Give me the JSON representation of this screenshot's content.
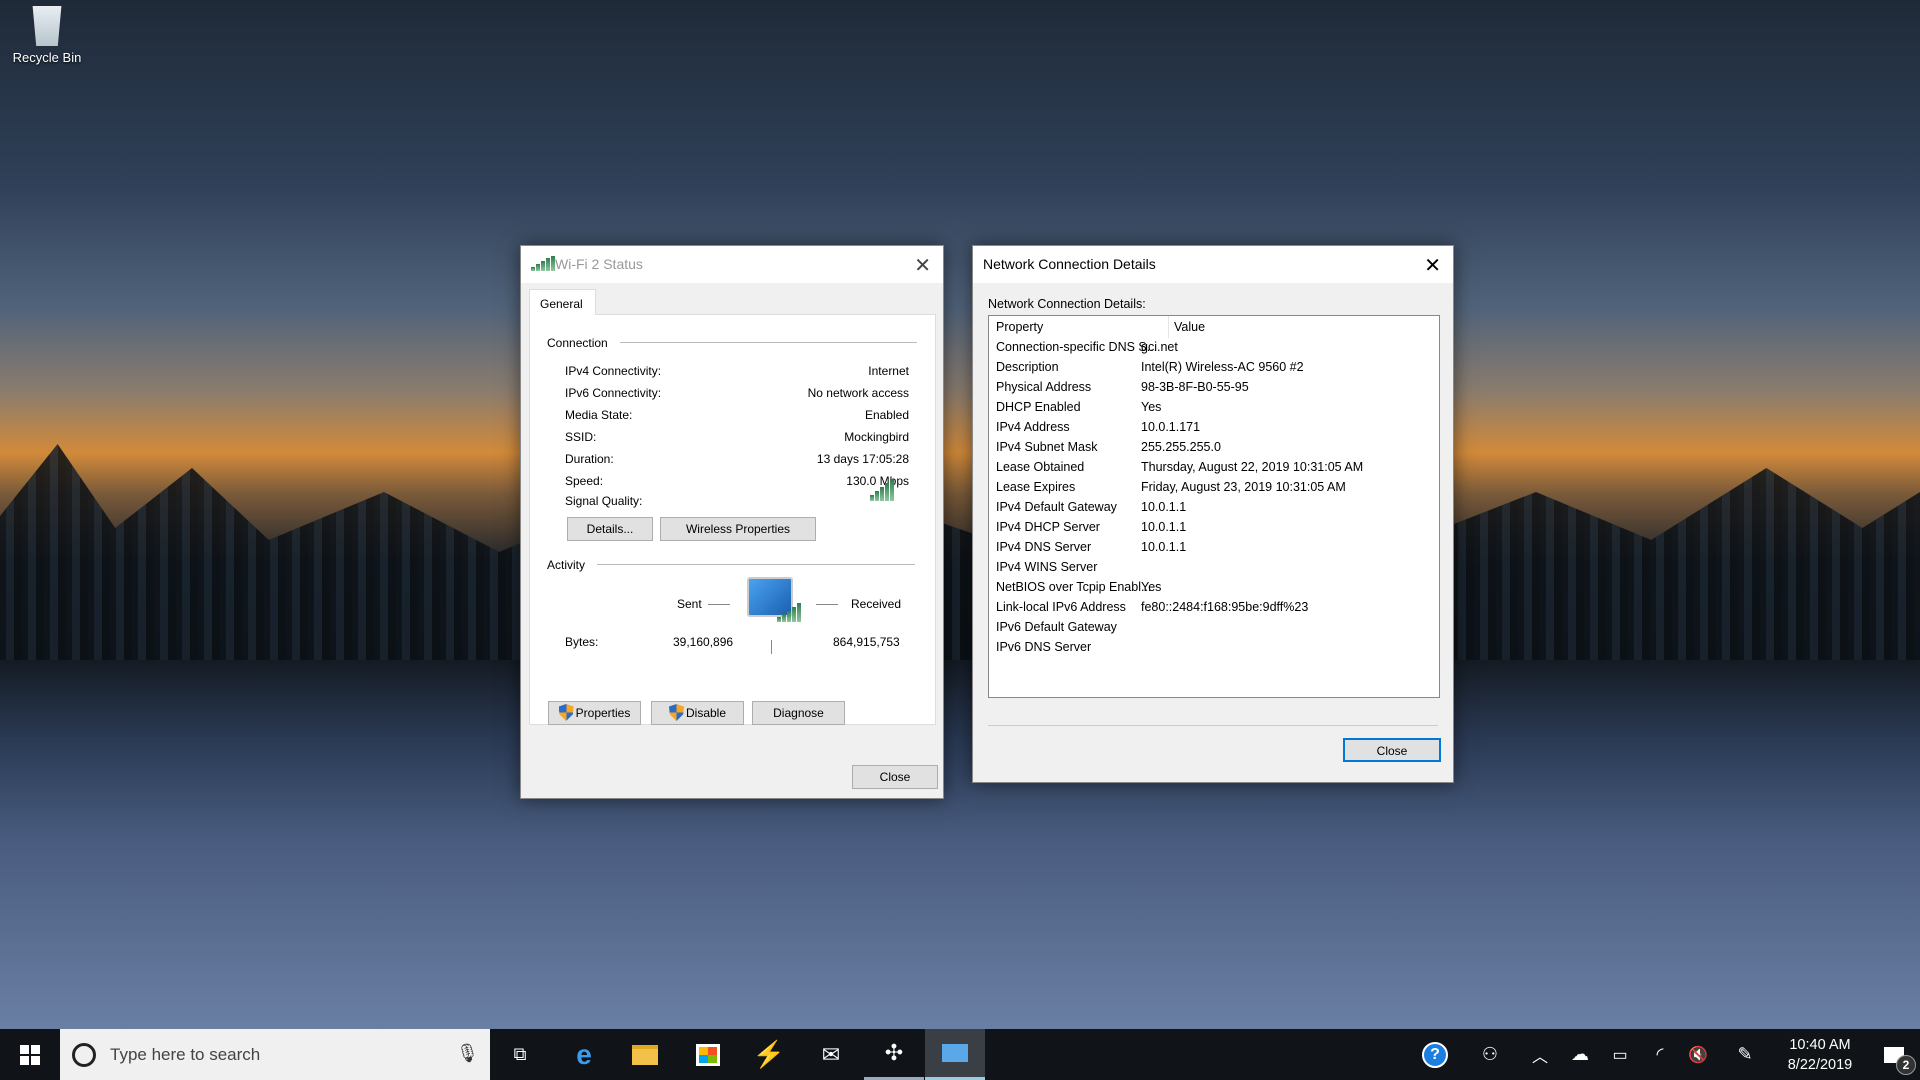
{
  "desktop": {
    "recycle_bin_label": "Recycle Bin"
  },
  "wifi_dialog": {
    "title": "Wi-Fi 2 Status",
    "tab": "General",
    "connection_heading": "Connection",
    "fields": [
      {
        "label": "IPv4 Connectivity:",
        "value": "Internet"
      },
      {
        "label": "IPv6 Connectivity:",
        "value": "No network access"
      },
      {
        "label": "Media State:",
        "value": "Enabled"
      },
      {
        "label": "SSID:",
        "value": "Mockingbird"
      },
      {
        "label": "Duration:",
        "value": "13 days 17:05:28"
      },
      {
        "label": "Speed:",
        "value": "130.0 Mbps"
      }
    ],
    "signal_label": "Signal Quality:",
    "signal_bars": 5,
    "details_button": "Details...",
    "wireless_properties_button": "Wireless Properties",
    "activity_heading": "Activity",
    "sent_label": "Sent",
    "received_label": "Received",
    "bytes_label": "Bytes:",
    "bytes_sent": "39,160,896",
    "bytes_received": "864,915,753",
    "properties_button": "Properties",
    "disable_button": "Disable",
    "diagnose_button": "Diagnose",
    "close_button": "Close"
  },
  "details_dialog": {
    "title": "Network Connection Details",
    "caption": "Network Connection Details:",
    "columns": [
      "Property",
      "Value"
    ],
    "rows": [
      [
        "Connection-specific DNS S...",
        "gci.net"
      ],
      [
        "Description",
        "Intel(R) Wireless-AC 9560 #2"
      ],
      [
        "Physical Address",
        "98-3B-8F-B0-55-95"
      ],
      [
        "DHCP Enabled",
        "Yes"
      ],
      [
        "IPv4 Address",
        "10.0.1.171"
      ],
      [
        "IPv4 Subnet Mask",
        "255.255.255.0"
      ],
      [
        "Lease Obtained",
        "Thursday, August 22, 2019 10:31:05 AM"
      ],
      [
        "Lease Expires",
        "Friday, August 23, 2019 10:31:05 AM"
      ],
      [
        "IPv4 Default Gateway",
        "10.0.1.1"
      ],
      [
        "IPv4 DHCP Server",
        "10.0.1.1"
      ],
      [
        "IPv4 DNS Server",
        "10.0.1.1"
      ],
      [
        "IPv4 WINS Server",
        ""
      ],
      [
        "NetBIOS over Tcpip Enabl...",
        "Yes"
      ],
      [
        "Link-local IPv6 Address",
        "fe80::2484:f168:95be:9dff%23"
      ],
      [
        "IPv6 Default Gateway",
        ""
      ],
      [
        "IPv6 DNS Server",
        ""
      ]
    ],
    "close_button": "Close"
  },
  "taskbar": {
    "search_placeholder": "Type here to search",
    "time": "10:40 AM",
    "date": "8/22/2019",
    "notification_count": "2",
    "accent": "#0078d7"
  }
}
